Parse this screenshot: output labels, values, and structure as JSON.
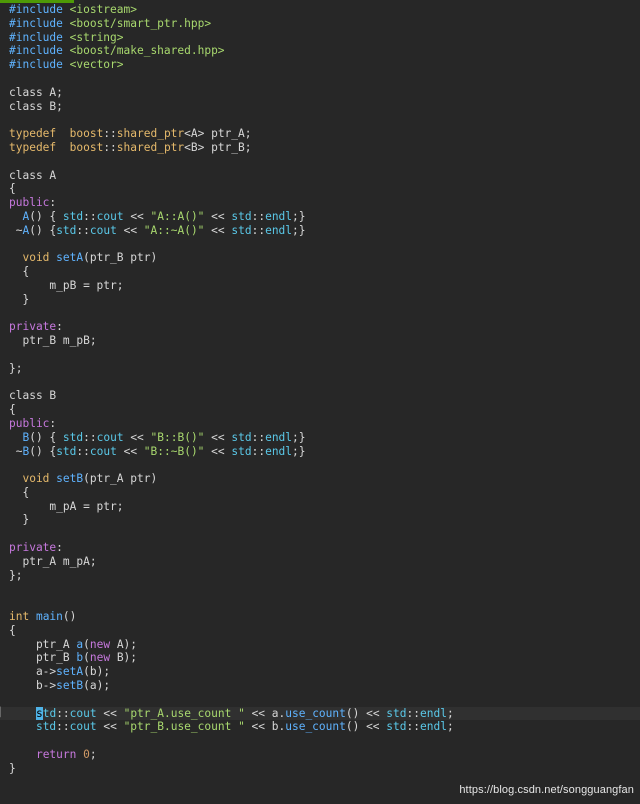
{
  "editor": {
    "lines": [
      [
        {
          "t": "#include ",
          "c": "pp"
        },
        {
          "t": "<iostream>",
          "c": "str"
        }
      ],
      [
        {
          "t": "#include ",
          "c": "pp"
        },
        {
          "t": "<boost/smart_ptr.hpp>",
          "c": "str"
        }
      ],
      [
        {
          "t": "#include ",
          "c": "pp"
        },
        {
          "t": "<string>",
          "c": "str"
        }
      ],
      [
        {
          "t": "#include ",
          "c": "pp"
        },
        {
          "t": "<boost/make_shared.hpp>",
          "c": "str"
        }
      ],
      [
        {
          "t": "#include ",
          "c": "pp"
        },
        {
          "t": "<vector>",
          "c": "str"
        }
      ],
      [],
      [
        {
          "t": "class A;",
          "c": "punc"
        }
      ],
      [
        {
          "t": "class B;",
          "c": "punc"
        }
      ],
      [],
      [
        {
          "t": "typedef  ",
          "c": "ty"
        },
        {
          "t": "boost",
          "c": "ty"
        },
        {
          "t": "::",
          "c": "punc"
        },
        {
          "t": "shared_ptr",
          "c": "ty"
        },
        {
          "t": "<A> ptr_A;",
          "c": "punc"
        }
      ],
      [
        {
          "t": "typedef  ",
          "c": "ty"
        },
        {
          "t": "boost",
          "c": "ty"
        },
        {
          "t": "::",
          "c": "punc"
        },
        {
          "t": "shared_ptr",
          "c": "ty"
        },
        {
          "t": "<B> ptr_B;",
          "c": "punc"
        }
      ],
      [],
      [
        {
          "t": "class A",
          "c": "punc"
        }
      ],
      [
        {
          "t": "{",
          "c": "punc"
        }
      ],
      [
        {
          "t": "public",
          "c": "kw"
        },
        {
          "t": ":",
          "c": "punc"
        }
      ],
      [
        {
          "t": "  ",
          "c": "punc"
        },
        {
          "t": "A",
          "c": "fn"
        },
        {
          "t": "() { ",
          "c": "punc"
        },
        {
          "t": "std",
          "c": "ns"
        },
        {
          "t": "::",
          "c": "punc"
        },
        {
          "t": "cout",
          "c": "ns"
        },
        {
          "t": " << ",
          "c": "punc"
        },
        {
          "t": "\"A::A()\"",
          "c": "str"
        },
        {
          "t": " << ",
          "c": "punc"
        },
        {
          "t": "std",
          "c": "ns"
        },
        {
          "t": "::",
          "c": "punc"
        },
        {
          "t": "endl",
          "c": "ns"
        },
        {
          "t": ";}",
          "c": "punc"
        }
      ],
      [
        {
          "t": " ~",
          "c": "punc"
        },
        {
          "t": "A",
          "c": "fn"
        },
        {
          "t": "() {",
          "c": "punc"
        },
        {
          "t": "std",
          "c": "ns"
        },
        {
          "t": "::",
          "c": "punc"
        },
        {
          "t": "cout",
          "c": "ns"
        },
        {
          "t": " << ",
          "c": "punc"
        },
        {
          "t": "\"A::~A()\"",
          "c": "str"
        },
        {
          "t": " << ",
          "c": "punc"
        },
        {
          "t": "std",
          "c": "ns"
        },
        {
          "t": "::",
          "c": "punc"
        },
        {
          "t": "endl",
          "c": "ns"
        },
        {
          "t": ";}",
          "c": "punc"
        }
      ],
      [],
      [
        {
          "t": "  void ",
          "c": "ty"
        },
        {
          "t": "setA",
          "c": "fn"
        },
        {
          "t": "(ptr_B ptr)",
          "c": "punc"
        }
      ],
      [
        {
          "t": "  {",
          "c": "punc"
        }
      ],
      [
        {
          "t": "      m_pB = ptr;",
          "c": "punc"
        }
      ],
      [
        {
          "t": "  }",
          "c": "punc"
        }
      ],
      [],
      [
        {
          "t": "private",
          "c": "kw"
        },
        {
          "t": ":",
          "c": "punc"
        }
      ],
      [
        {
          "t": "  ptr_B m_pB;",
          "c": "punc"
        }
      ],
      [],
      [
        {
          "t": "};",
          "c": "punc"
        }
      ],
      [],
      [
        {
          "t": "class B",
          "c": "punc"
        }
      ],
      [
        {
          "t": "{",
          "c": "punc"
        }
      ],
      [
        {
          "t": "public",
          "c": "kw"
        },
        {
          "t": ":",
          "c": "punc"
        }
      ],
      [
        {
          "t": "  ",
          "c": "punc"
        },
        {
          "t": "B",
          "c": "fn"
        },
        {
          "t": "() { ",
          "c": "punc"
        },
        {
          "t": "std",
          "c": "ns"
        },
        {
          "t": "::",
          "c": "punc"
        },
        {
          "t": "cout",
          "c": "ns"
        },
        {
          "t": " << ",
          "c": "punc"
        },
        {
          "t": "\"B::B()\"",
          "c": "str"
        },
        {
          "t": " << ",
          "c": "punc"
        },
        {
          "t": "std",
          "c": "ns"
        },
        {
          "t": "::",
          "c": "punc"
        },
        {
          "t": "endl",
          "c": "ns"
        },
        {
          "t": ";}",
          "c": "punc"
        }
      ],
      [
        {
          "t": " ~",
          "c": "punc"
        },
        {
          "t": "B",
          "c": "fn"
        },
        {
          "t": "() {",
          "c": "punc"
        },
        {
          "t": "std",
          "c": "ns"
        },
        {
          "t": "::",
          "c": "punc"
        },
        {
          "t": "cout",
          "c": "ns"
        },
        {
          "t": " << ",
          "c": "punc"
        },
        {
          "t": "\"B::~B()\"",
          "c": "str"
        },
        {
          "t": " << ",
          "c": "punc"
        },
        {
          "t": "std",
          "c": "ns"
        },
        {
          "t": "::",
          "c": "punc"
        },
        {
          "t": "endl",
          "c": "ns"
        },
        {
          "t": ";}",
          "c": "punc"
        }
      ],
      [],
      [
        {
          "t": "  void ",
          "c": "ty"
        },
        {
          "t": "setB",
          "c": "fn"
        },
        {
          "t": "(ptr_A ptr)",
          "c": "punc"
        }
      ],
      [
        {
          "t": "  {",
          "c": "punc"
        }
      ],
      [
        {
          "t": "      m_pA = ptr;",
          "c": "punc"
        }
      ],
      [
        {
          "t": "  }",
          "c": "punc"
        }
      ],
      [],
      [
        {
          "t": "private",
          "c": "kw"
        },
        {
          "t": ":",
          "c": "punc"
        }
      ],
      [
        {
          "t": "  ptr_A m_pA;",
          "c": "punc"
        }
      ],
      [
        {
          "t": "};",
          "c": "punc"
        }
      ],
      [],
      [],
      [
        {
          "t": "int ",
          "c": "ty"
        },
        {
          "t": "main",
          "c": "fn"
        },
        {
          "t": "()",
          "c": "punc"
        }
      ],
      [
        {
          "t": "{",
          "c": "punc"
        }
      ],
      [
        {
          "t": "    ptr_A ",
          "c": "punc"
        },
        {
          "t": "a",
          "c": "fn"
        },
        {
          "t": "(",
          "c": "punc"
        },
        {
          "t": "new",
          "c": "kw"
        },
        {
          "t": " A);",
          "c": "punc"
        }
      ],
      [
        {
          "t": "    ptr_B ",
          "c": "punc"
        },
        {
          "t": "b",
          "c": "fn"
        },
        {
          "t": "(",
          "c": "punc"
        },
        {
          "t": "new",
          "c": "kw"
        },
        {
          "t": " B);",
          "c": "punc"
        }
      ],
      [
        {
          "t": "    a->",
          "c": "punc"
        },
        {
          "t": "setA",
          "c": "fn"
        },
        {
          "t": "(b);",
          "c": "punc"
        }
      ],
      [
        {
          "t": "    b->",
          "c": "punc"
        },
        {
          "t": "setB",
          "c": "fn"
        },
        {
          "t": "(a);",
          "c": "punc"
        }
      ],
      [],
      [
        {
          "t": "    ",
          "c": "punc"
        },
        {
          "t": "s",
          "c": "cursor"
        },
        {
          "t": "td",
          "c": "ns"
        },
        {
          "t": "::",
          "c": "punc"
        },
        {
          "t": "cout",
          "c": "ns"
        },
        {
          "t": " << ",
          "c": "punc"
        },
        {
          "t": "\"ptr_A.use_count \"",
          "c": "str"
        },
        {
          "t": " << a.",
          "c": "punc"
        },
        {
          "t": "use_count",
          "c": "fn"
        },
        {
          "t": "() << ",
          "c": "punc"
        },
        {
          "t": "std",
          "c": "ns"
        },
        {
          "t": "::",
          "c": "punc"
        },
        {
          "t": "endl",
          "c": "ns"
        },
        {
          "t": ";",
          "c": "punc"
        }
      ],
      [
        {
          "t": "    ",
          "c": "punc"
        },
        {
          "t": "std",
          "c": "ns"
        },
        {
          "t": "::",
          "c": "punc"
        },
        {
          "t": "cout",
          "c": "ns"
        },
        {
          "t": " << ",
          "c": "punc"
        },
        {
          "t": "\"ptr_B.use_count \"",
          "c": "str"
        },
        {
          "t": " << b.",
          "c": "punc"
        },
        {
          "t": "use_count",
          "c": "fn"
        },
        {
          "t": "() << ",
          "c": "punc"
        },
        {
          "t": "std",
          "c": "ns"
        },
        {
          "t": "::",
          "c": "punc"
        },
        {
          "t": "endl",
          "c": "ns"
        },
        {
          "t": ";",
          "c": "punc"
        }
      ],
      [],
      [
        {
          "t": "    ",
          "c": "punc"
        },
        {
          "t": "return ",
          "c": "kw"
        },
        {
          "t": "0",
          "c": "num"
        },
        {
          "t": ";",
          "c": "punc"
        }
      ],
      [
        {
          "t": "}",
          "c": "punc"
        }
      ]
    ],
    "cursor_line_index": 51
  },
  "colors": {
    "background": "#272727",
    "keyword": "#c678dd",
    "preprocessor": "#5fb3ff",
    "string": "#a8d86e",
    "type": "#e5b96b",
    "namespace": "#5ac8e8",
    "function": "#5fb3ff",
    "number": "#d19a66",
    "text": "#d7d7d7"
  },
  "watermark": {
    "text": "https://blog.csdn.net/songguangfan"
  }
}
